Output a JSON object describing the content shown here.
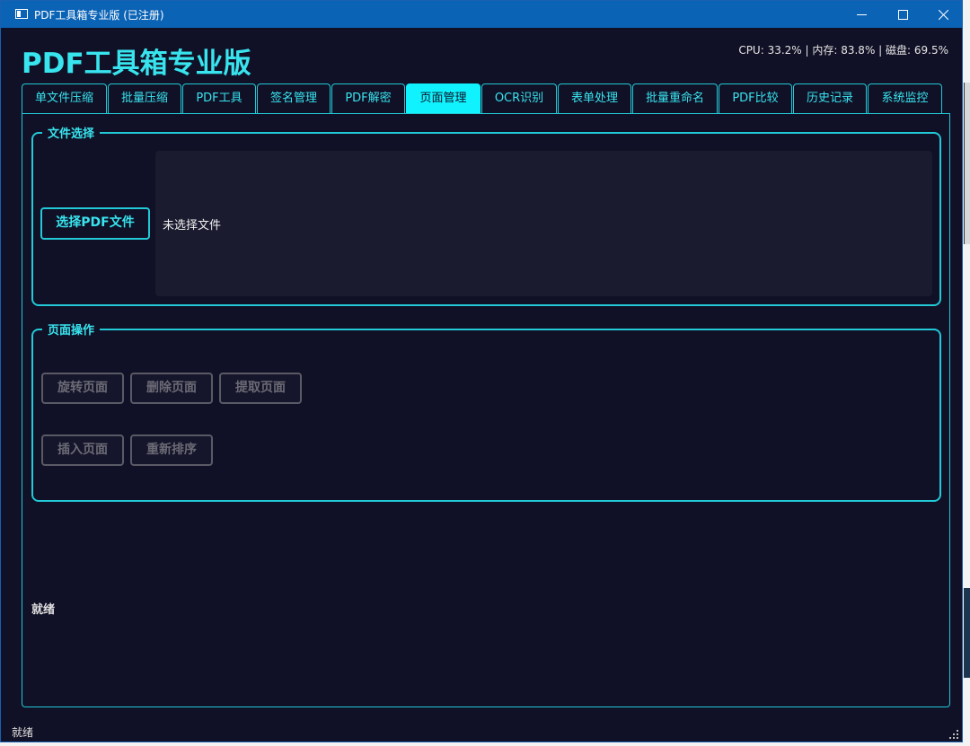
{
  "window": {
    "title": "PDF工具箱专业版 (已注册)",
    "controls": {
      "minimize": "—",
      "maximize": "☐",
      "close": "✕"
    }
  },
  "header": {
    "app_title": "PDF工具箱专业版",
    "sys_stats": "CPU: 33.2% | 内存: 83.8% | 磁盘: 69.5%"
  },
  "tabs": [
    {
      "label": "单文件压缩",
      "active": false
    },
    {
      "label": "批量压缩",
      "active": false
    },
    {
      "label": "PDF工具",
      "active": false
    },
    {
      "label": "签名管理",
      "active": false
    },
    {
      "label": "PDF解密",
      "active": false
    },
    {
      "label": "页面管理",
      "active": true
    },
    {
      "label": "OCR识别",
      "active": false
    },
    {
      "label": "表单处理",
      "active": false
    },
    {
      "label": "批量重命名",
      "active": false
    },
    {
      "label": "PDF比较",
      "active": false
    },
    {
      "label": "历史记录",
      "active": false
    },
    {
      "label": "系统监控",
      "active": false
    }
  ],
  "file_select": {
    "group_title": "文件选择",
    "button_label": "选择PDF文件",
    "file_status": "未选择文件"
  },
  "page_ops": {
    "group_title": "页面操作",
    "buttons": [
      "旋转页面",
      "删除页面",
      "提取页面",
      "插入页面",
      "重新排序"
    ]
  },
  "status": {
    "inner": "就绪",
    "bottom": "就绪"
  },
  "colors": {
    "accent": "#22c9d6",
    "title_bar": "#0b63b6",
    "background": "#101026",
    "active_tab": "#10f3ff"
  }
}
